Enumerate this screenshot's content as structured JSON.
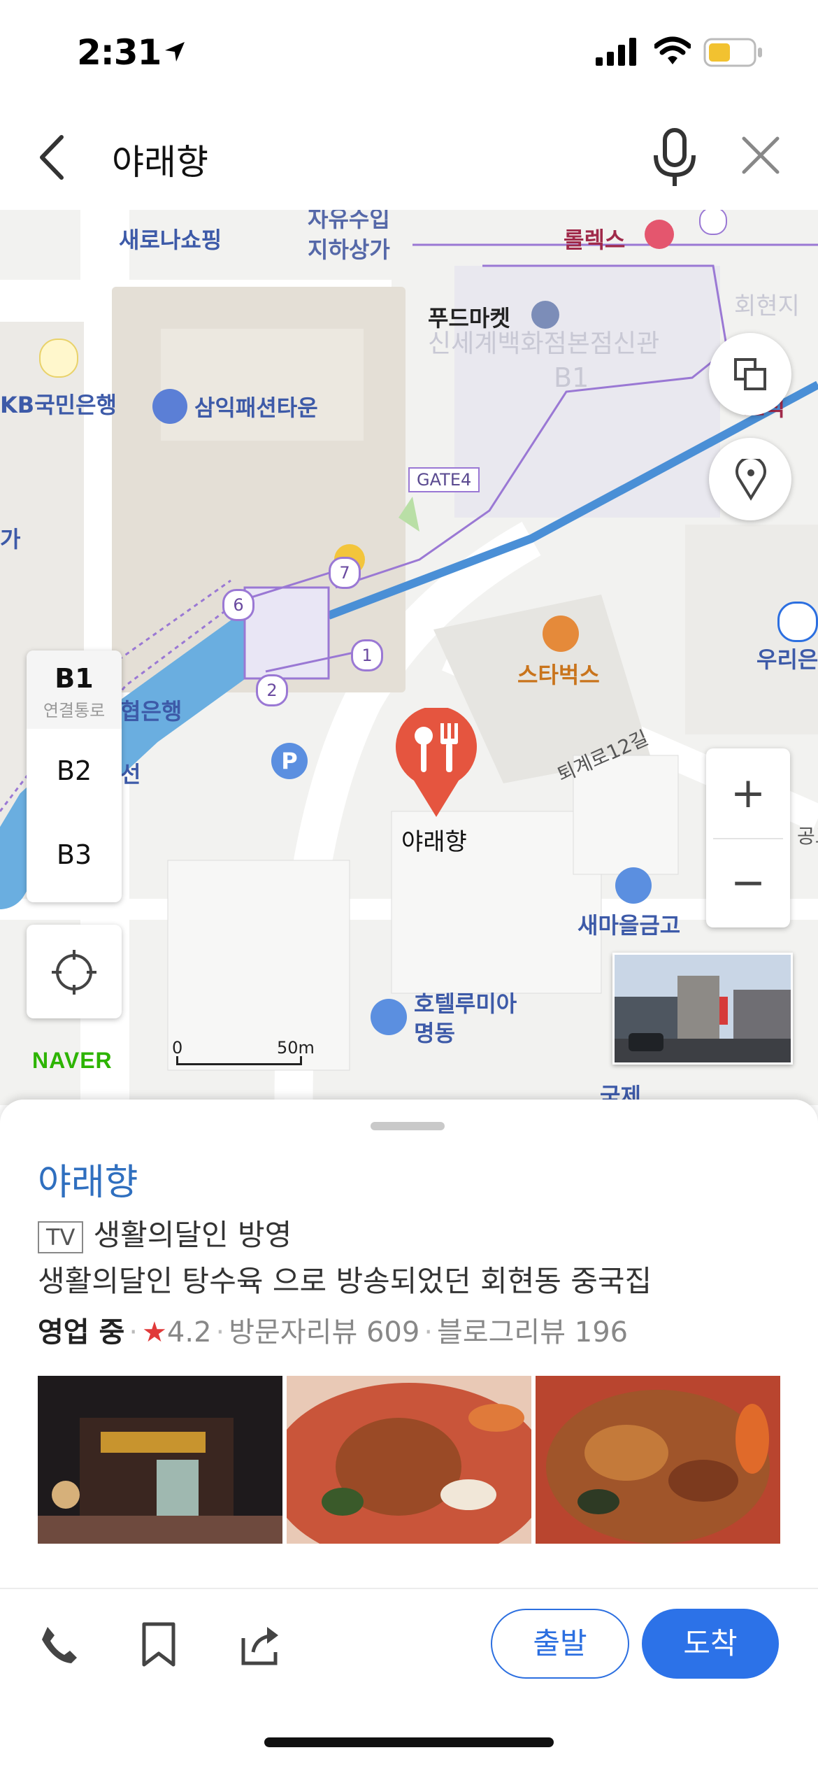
{
  "status_bar": {
    "time": "2:31"
  },
  "search": {
    "query": "야래향"
  },
  "map": {
    "labels": {
      "saerona": "새로나쇼핑",
      "jayu_1": "자유수입",
      "jayu_2": "지하상가",
      "rolex": "롤렉스",
      "foodmarket": "푸드마켓",
      "shinsegae": "신세계백화점본점신관",
      "b1_floor": "B1",
      "kb": "KB국민은행",
      "samik": "삼익패션타운",
      "gate4": "GATE4",
      "ga": "가",
      "starbucks": "스타벅스",
      "woori": "우리은",
      "hyeop": "협은행",
      "seon": "선",
      "toegye": "퇴계로12길",
      "place": "야래향",
      "saemaeul": "새마을금고",
      "hotel_1": "호텔루미아",
      "hotel_2": "명동",
      "gongro": "공로",
      "guje": "국제",
      "hoehyeon": "회현지",
      "bosuk": "보석",
      "naver": "NAVER",
      "scale_zero": "0",
      "scale_dist": "50m",
      "exit_1": "1",
      "exit_2": "2",
      "exit_6": "6",
      "exit_7": "7"
    },
    "floors": {
      "b1": "B1",
      "b1_sub": "연결통로",
      "b2": "B2",
      "b3": "B3"
    },
    "zoom": {
      "in": "+",
      "out": "−"
    }
  },
  "place": {
    "name": "야래향",
    "tv_badge": "TV",
    "tv_text": "생활의달인 방영",
    "description": "생활의달인 탕수육 으로 방송되었던 회현동 중국집",
    "status": "영업 중",
    "rating": "4.2",
    "visitor_review": "방문자리뷰 609",
    "blog_review": "블로그리뷰 196"
  },
  "actions": {
    "depart": "출발",
    "arrive": "도착"
  },
  "colors": {
    "accent": "#2c72e8",
    "route": "#4a8fd6",
    "marker": "#e5553f",
    "starbucks": "#d9822b",
    "naver": "#2db400"
  }
}
